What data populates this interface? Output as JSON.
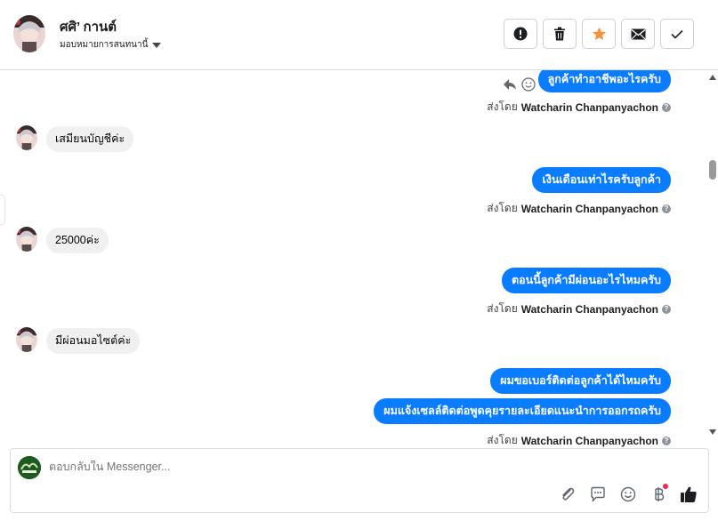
{
  "header": {
    "contact_name": "ศศิ’ กานต์",
    "assign_label": "มอบหมายการสนทนานี้"
  },
  "actions": [
    {
      "name": "mark-spam-button",
      "icon": "exclamation-circle-icon"
    },
    {
      "name": "delete-button",
      "icon": "trash-icon"
    },
    {
      "name": "star-button",
      "icon": "star-icon",
      "color": "#f7923b"
    },
    {
      "name": "mark-unread-button",
      "icon": "envelope-icon"
    },
    {
      "name": "mark-done-button",
      "icon": "check-icon"
    }
  ],
  "thread": {
    "messages": [
      {
        "direction": "out",
        "text": "ลูกค้าทำอาชีพอะไรครับ"
      },
      {
        "direction": "in",
        "text": "เสมียนบัญชีค่ะ"
      },
      {
        "direction": "out",
        "text": "เงินเดือนเท่าไรครับลูกค้า"
      },
      {
        "direction": "in",
        "text": "25000ค่ะ"
      },
      {
        "direction": "out",
        "text": "ตอนนี้ลูกค้ามีผ่อนอะไรไหมครับ"
      },
      {
        "direction": "in",
        "text": "มีผ่อนมอไซต์ค่ะ"
      },
      {
        "direction": "out",
        "text": "ผมขอเบอร์ติดต่อลูกค้าได้ไหมครับ"
      },
      {
        "direction": "out",
        "text": "ผมแจ้งเซลล์ติดต่อพูดคุยรายละเอียดแนะนำการออกรถครับ"
      }
    ],
    "sent_by_label": "ส่งโดย",
    "sender_name": "Watcharin Chanpanyachon",
    "help_glyph": "?"
  },
  "composer": {
    "placeholder": "ตอบกลับใน Messenger...",
    "tools": [
      "paperclip-icon",
      "saved-reply-icon",
      "emoji-icon",
      "baht-payment-icon",
      "thumbs-up-icon"
    ]
  },
  "colors": {
    "outgoing_bubble": "#0a7cff",
    "incoming_bubble": "#f0f0f0",
    "star": "#f7923b",
    "like": "#1c1e21"
  }
}
